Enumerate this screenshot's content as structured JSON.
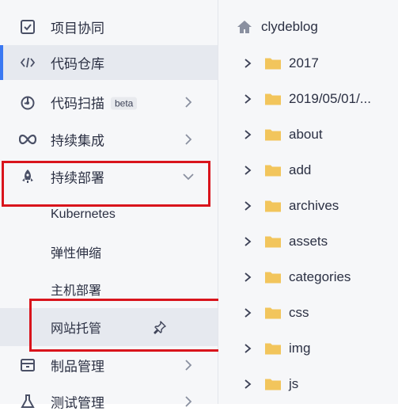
{
  "sidebar": {
    "items": [
      {
        "label": "项目协同",
        "icon": "checkbox-icon"
      },
      {
        "label": "代码仓库",
        "icon": "code-icon",
        "active": true
      },
      {
        "label": "代码扫描",
        "badge": "beta",
        "icon": "scan-icon"
      },
      {
        "label": "持续集成",
        "icon": "infinity-icon"
      },
      {
        "label": "持续部署",
        "icon": "rocket-icon",
        "expanded": true
      },
      {
        "label": "制品管理",
        "icon": "package-icon"
      },
      {
        "label": "测试管理",
        "icon": "flask-icon"
      }
    ],
    "deploy_sub_items": [
      {
        "label": "Kubernetes"
      },
      {
        "label": "弹性伸缩"
      },
      {
        "label": "主机部署"
      },
      {
        "label": "网站托管",
        "pin_icon": "pin-icon"
      }
    ]
  },
  "file_tree": {
    "root": {
      "label": "clydeblog",
      "icon": "home-icon"
    },
    "folders": [
      {
        "label": "2017"
      },
      {
        "label": "2019/05/01/..."
      },
      {
        "label": "about"
      },
      {
        "label": "add"
      },
      {
        "label": "archives"
      },
      {
        "label": "assets"
      },
      {
        "label": "categories"
      },
      {
        "label": "css"
      },
      {
        "label": "img"
      },
      {
        "label": "js"
      }
    ]
  },
  "colors": {
    "accent": "#3a78f2",
    "highlight": "#d9141c",
    "folder": "#f2c55c",
    "sidebar_bg": "#f6f7f9",
    "active_bg": "#e6e9ef"
  }
}
